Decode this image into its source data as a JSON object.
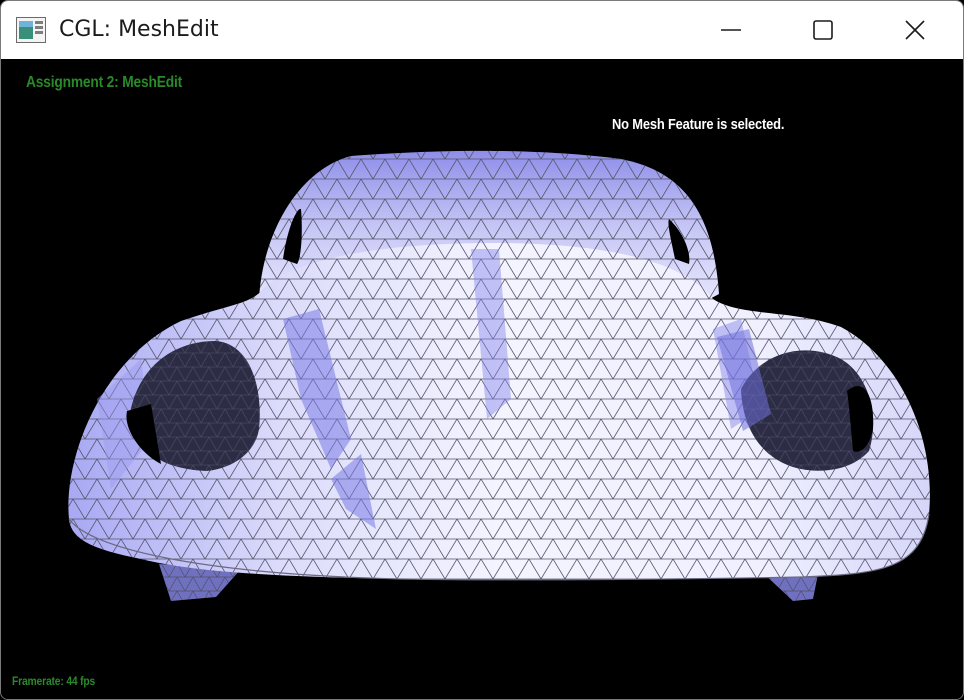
{
  "window": {
    "title": "CGL: MeshEdit"
  },
  "controls": {
    "minimize_icon": "minimize-icon",
    "maximize_icon": "maximize-icon",
    "close_icon": "close-icon"
  },
  "hud": {
    "assignment_title": "Assignment 2: MeshEdit",
    "selection_status": "No Mesh Feature is selected.",
    "framerate": "Framerate: 44 fps"
  },
  "colors": {
    "hud_title": "#2a8a2a",
    "hud_text": "#ffffff",
    "background": "#000000",
    "mesh_fill": "#e6e6ff",
    "mesh_shade": "#8080ee",
    "mesh_edge": "#5a5a66"
  }
}
